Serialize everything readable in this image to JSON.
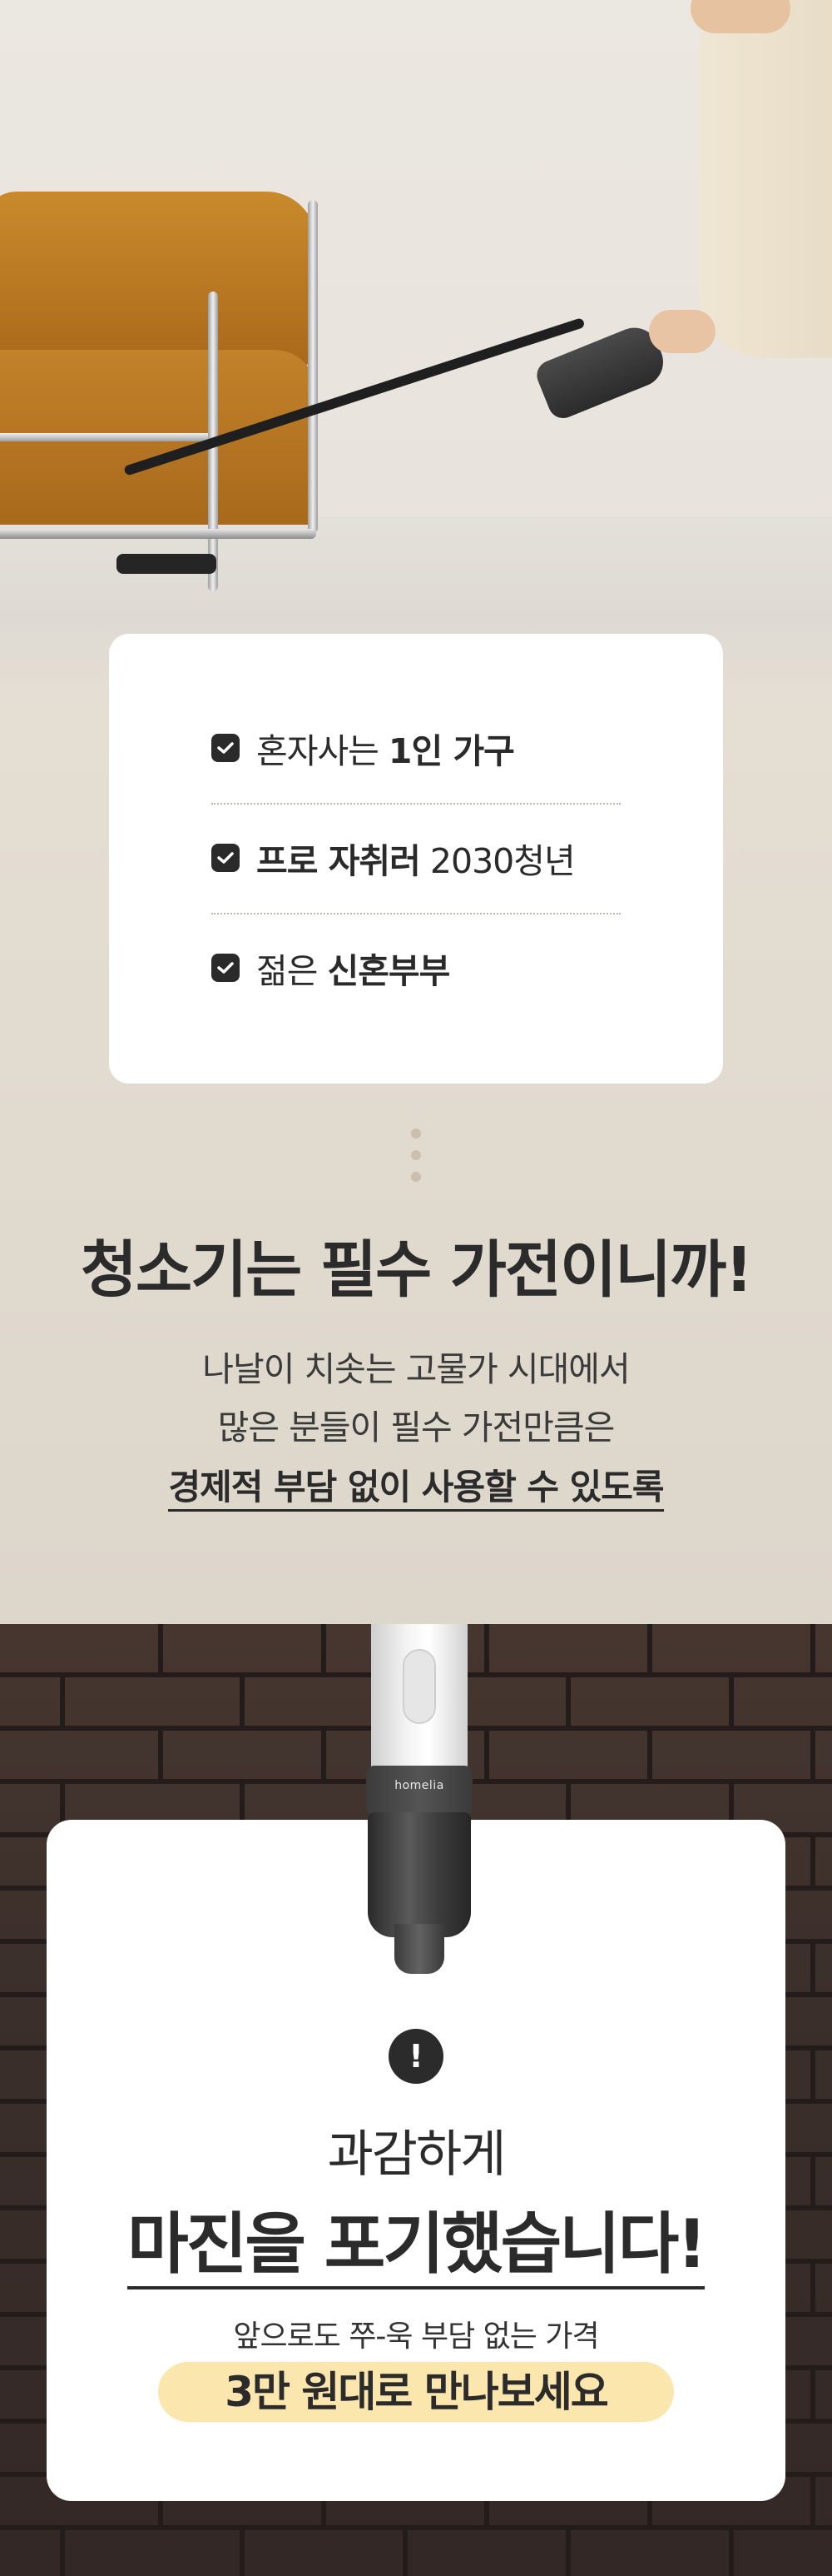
{
  "checklist": {
    "items": [
      {
        "prefix": "혼자사는 ",
        "bold": "1인 가구",
        "suffix": ""
      },
      {
        "prefix": "",
        "bold": "프로 자취러",
        "suffix": " 2030청년"
      },
      {
        "prefix": "젊은 ",
        "bold": "신혼부부",
        "suffix": ""
      }
    ]
  },
  "intro": {
    "headline": "청소기는 필수 가전이니까!",
    "line1": "나날이 치솟는 고물가 시대에서",
    "line2": "많은 분들이 필수 가전만큼은",
    "line3": "경제적 부담 없이 사용할 수 있도록"
  },
  "product": {
    "brand_logo": "homelia"
  },
  "price_card": {
    "alert_mark": "!",
    "line1": "과감하게",
    "line2": "마진을 포기했습니다!",
    "line3": "앞으로도 쭈-욱 부담 없는 가격",
    "highlight": "3만 원대로 만나보세요"
  },
  "colors": {
    "card_highlight": "#fbe6ad",
    "text_dark": "#2b2b2b",
    "background_beige": "#e2dbd0"
  }
}
